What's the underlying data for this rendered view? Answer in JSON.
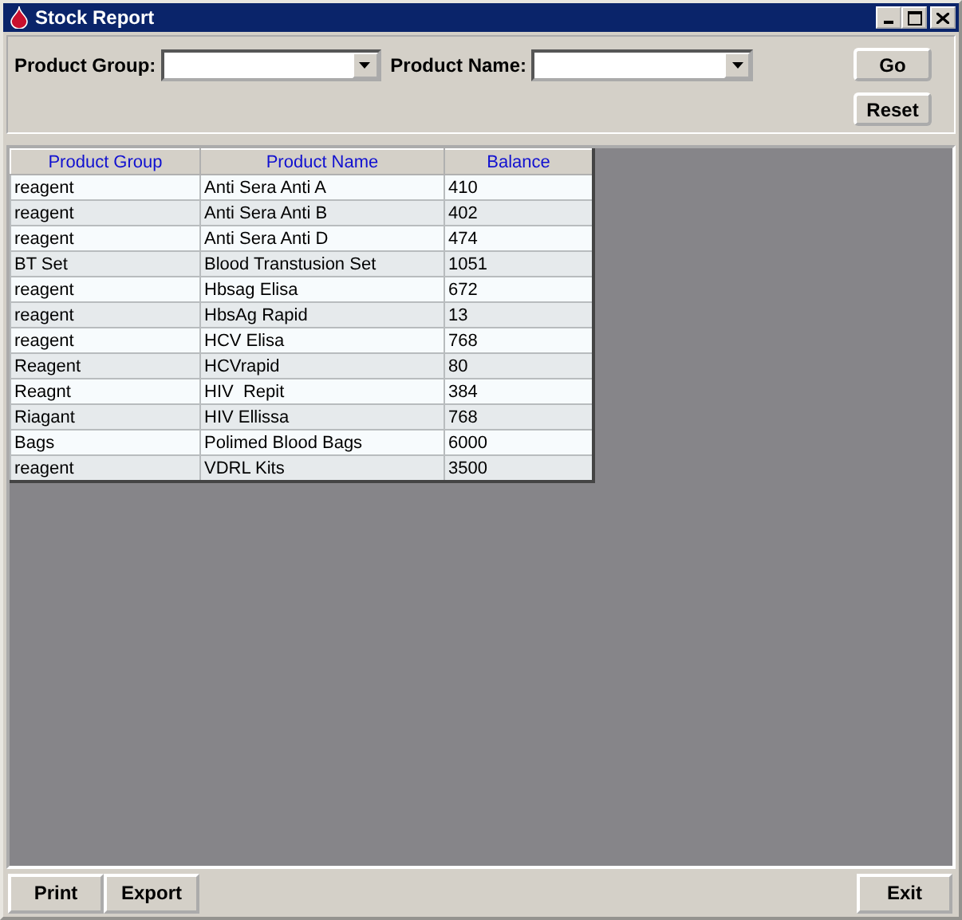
{
  "window": {
    "title": "Stock Report"
  },
  "filters": [
    {
      "label": "Product Group:"
    },
    {
      "label": "Product Name:"
    }
  ],
  "actions": [
    "Go",
    "Reset"
  ],
  "table": {
    "columns": [
      "Product Group",
      "Product Name",
      "Balance"
    ],
    "rows": [
      [
        "reagent",
        "Anti Sera Anti A",
        "410"
      ],
      [
        "reagent",
        "Anti Sera Anti B",
        "402"
      ],
      [
        "reagent",
        "Anti Sera Anti D",
        "474"
      ],
      [
        "BT Set",
        "Blood Transtusion Set",
        "1051"
      ],
      [
        "reagent",
        "Hbsag Elisa",
        "672"
      ],
      [
        "reagent",
        "HbsAg Rapid",
        "13"
      ],
      [
        "reagent",
        "HCV Elisa",
        "768"
      ],
      [
        "Reagent",
        "HCVrapid",
        "80"
      ],
      [
        "Reagnt",
        "HIV  Repit",
        "384"
      ],
      [
        "Riagant",
        "HIV Ellissa",
        "768"
      ],
      [
        "Bags",
        "Polimed Blood Bags",
        "6000"
      ],
      [
        "reagent",
        "VDRL Kits",
        "3500"
      ]
    ]
  },
  "footer_left": [
    "Print",
    "Export"
  ],
  "footer_right": [
    "Exit"
  ]
}
